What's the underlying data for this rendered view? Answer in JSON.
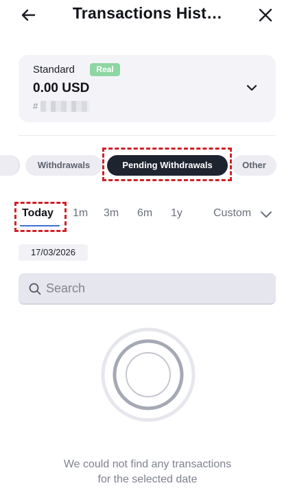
{
  "header": {
    "title": "Transactions Hist…"
  },
  "account": {
    "type": "Standard",
    "badge": "Real",
    "balance": "0.00 USD",
    "number_prefix": "#"
  },
  "filters": {
    "chips": [
      "Withdrawals",
      "Pending Withdrawals",
      "Other"
    ],
    "active": "Pending Withdrawals"
  },
  "periods": {
    "options": [
      "Today",
      "1m",
      "3m",
      "6m",
      "1y"
    ],
    "active": "Today",
    "custom_label": "Custom"
  },
  "date_range": "17/03/2026",
  "search": {
    "placeholder": "Search",
    "value": ""
  },
  "empty_state": {
    "line1": "We could not find any transactions",
    "line2": "for the selected date"
  },
  "colors": {
    "active_chip": "#1e2330",
    "real_badge": "#8ed6a2",
    "today_underline": "#3d6fd6",
    "highlight": "#d11f26"
  },
  "icons": [
    "back-arrow-icon",
    "close-icon",
    "chevron-down-icon",
    "search-icon",
    "empty-rings-icon"
  ]
}
